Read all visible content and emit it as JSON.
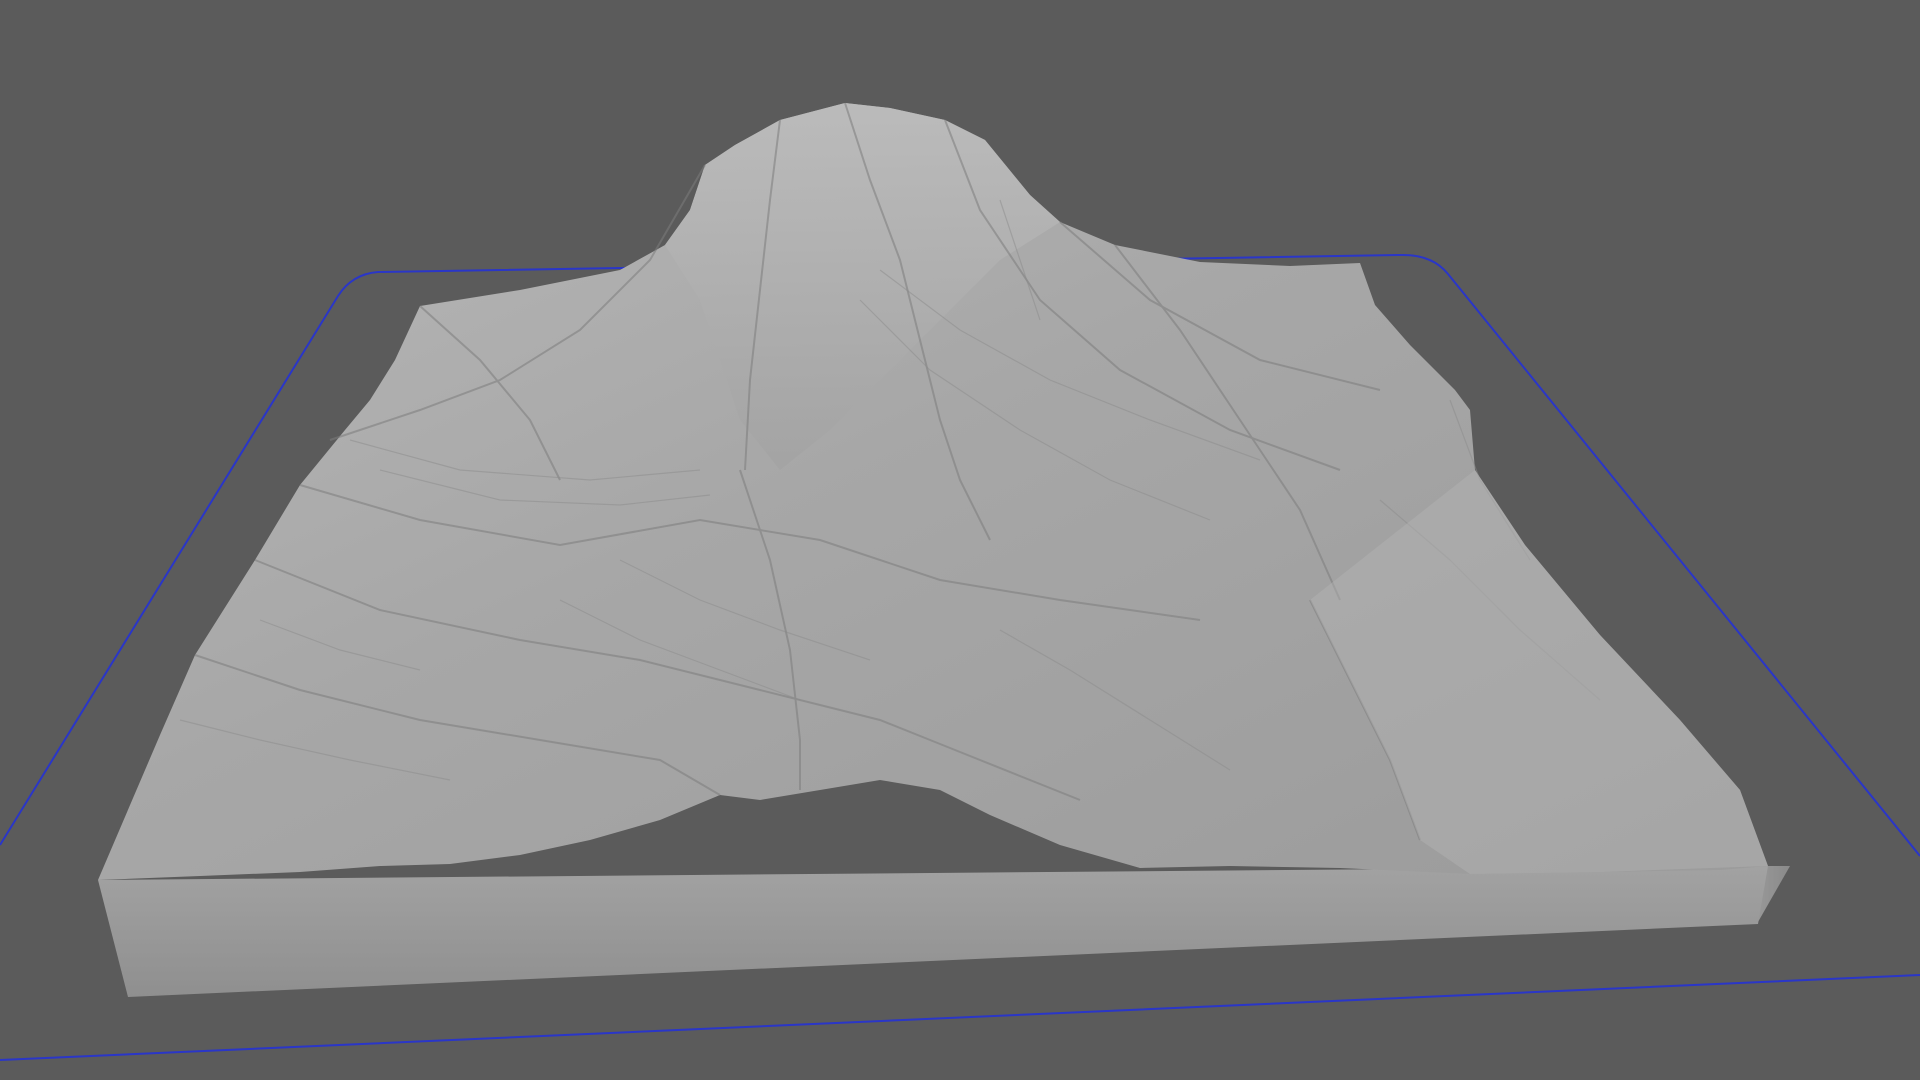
{
  "viewport": {
    "background_color": "#5b5b5b",
    "build_plate_outline_color": "#2a36c8"
  },
  "model": {
    "kind": "terrain relief model",
    "surface_color": "#a6a6a6",
    "base_side_color": "#9a9a9a"
  }
}
